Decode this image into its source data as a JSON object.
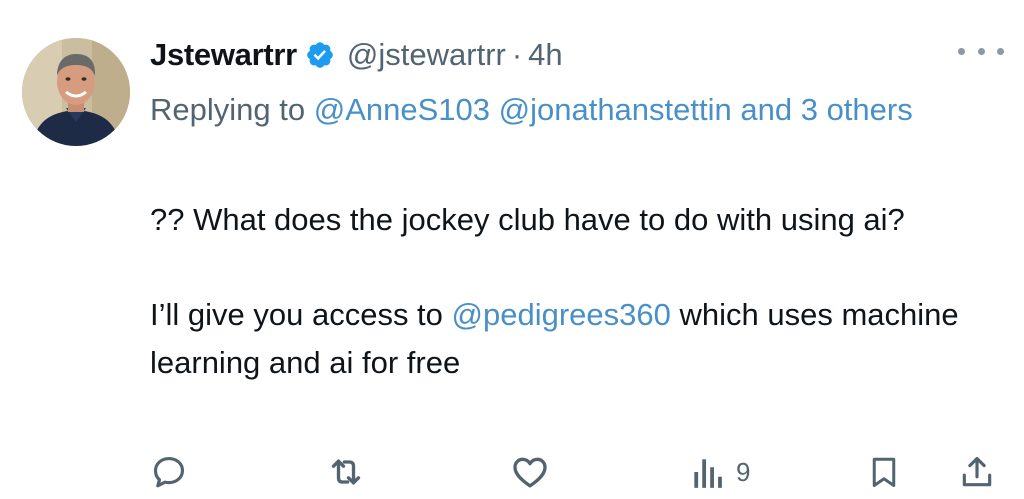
{
  "tweet": {
    "author": {
      "display_name": "Jstewartrr",
      "handle": "@jstewartrr",
      "verified": true,
      "avatar_icon": "avatar"
    },
    "separator": "·",
    "time": "4h",
    "replying": {
      "prefix": "Replying to ",
      "mention_1": "@AnneS103",
      "mention_2": "@jonathanstettin",
      "and_others": "and 3 others"
    },
    "text": {
      "paragraph_1": "?? What does the jockey club have to do with using ai?",
      "paragraph_2_before": "I’ll give you access to ",
      "paragraph_2_mention": "@pedigrees360",
      "paragraph_2_after": " which uses machine learning and ai for free"
    },
    "actions": {
      "views_count": "9"
    },
    "colors": {
      "mention": "#4a90c8",
      "muted": "#536471",
      "verified_blue": "#1d9bf0",
      "text": "#0f1419"
    },
    "icons": [
      "more-icon",
      "verified-badge-icon",
      "reply-icon",
      "retweet-icon",
      "like-icon",
      "views-icon",
      "bookmark-icon",
      "share-icon"
    ]
  }
}
